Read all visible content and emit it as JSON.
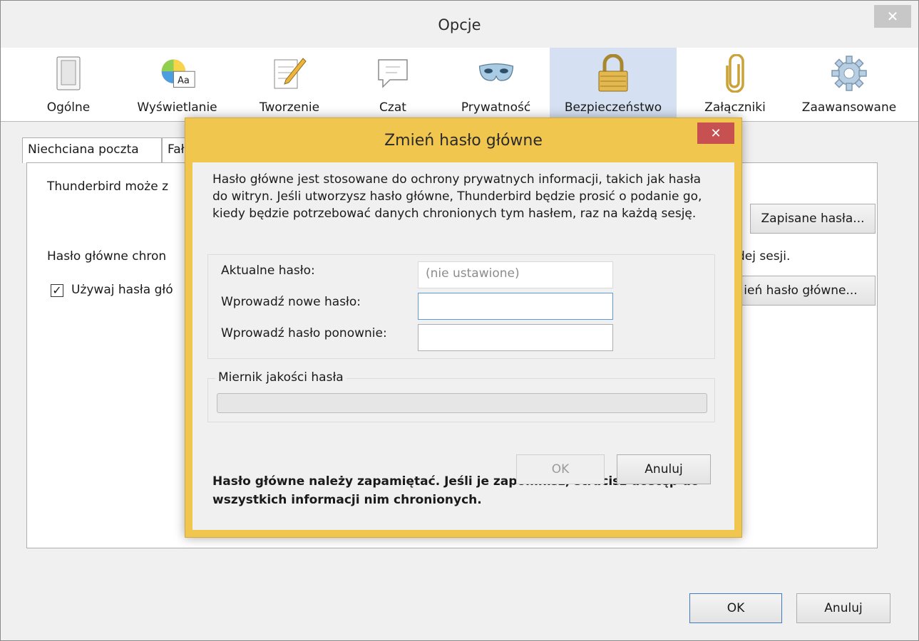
{
  "window": {
    "title": "Opcje",
    "close_glyph": "✕"
  },
  "toolbar": {
    "panes": [
      {
        "label": "Ogólne",
        "icon": "general-icon",
        "selected": false
      },
      {
        "label": "Wyświetlanie",
        "icon": "display-icon",
        "selected": false
      },
      {
        "label": "Tworzenie",
        "icon": "compose-icon",
        "selected": false
      },
      {
        "label": "Czat",
        "icon": "chat-icon",
        "selected": false
      },
      {
        "label": "Prywatność",
        "icon": "privacy-mask-icon",
        "selected": false
      },
      {
        "label": "Bezpieczeństwo",
        "icon": "security-lock-icon",
        "selected": true
      },
      {
        "label": "Załączniki",
        "icon": "attachment-paperclip-icon",
        "selected": false
      },
      {
        "label": "Zaawansowane",
        "icon": "advanced-gear-icon",
        "selected": false
      }
    ]
  },
  "subtabs": [
    "Niechciana poczta",
    "Fał"
  ],
  "security": {
    "intro_text": "Thunderbird może z",
    "saved_passwords_button": "Zapisane hasła...",
    "master_text_left": "Hasło główne chron",
    "master_text_right": "dej sesji.",
    "use_master_checkbox": {
      "checked": true,
      "label": "Używaj hasła głó"
    },
    "change_master_button": "ień hasło główne..."
  },
  "dialog": {
    "title": "Zmień hasło główne",
    "close_glyph": "✕",
    "intro": "Hasło główne jest stosowane do ochrony prywatnych informacji, takich jak hasła do witryn. Jeśli utworzysz hasło główne, Thunderbird będzie prosić o podanie go, kiedy będzie potrzebować danych chronionych tym hasłem, raz na każdą sesję.",
    "current_label": "Aktualne hasło:",
    "current_value": "(nie ustawione)",
    "new_label": "Wprowadź nowe hasło:",
    "new_value": "",
    "repeat_label": "Wprowadź hasło ponownie:",
    "repeat_value": "",
    "meter_label": "Miernik jakości hasła",
    "meter_level": 0,
    "warning": "Hasło główne należy zapamiętać. Jeśli je zapomnisz, stracisz dostęp do wszystkich informacji nim chronionych.",
    "ok_label": "OK",
    "cancel_label": "Anuluj"
  },
  "footer": {
    "ok_label": "OK",
    "cancel_label": "Anuluj"
  },
  "colors": {
    "dialog_frame": "#f1c64f",
    "selected_pane": "#d5e1f2",
    "dialog_close": "#c75050"
  }
}
